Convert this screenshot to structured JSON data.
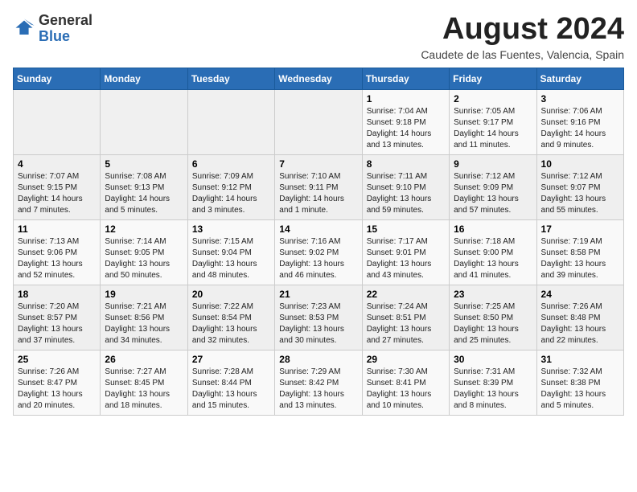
{
  "logo": {
    "general": "General",
    "blue": "Blue"
  },
  "title": "August 2024",
  "location": "Caudete de las Fuentes, Valencia, Spain",
  "weekdays": [
    "Sunday",
    "Monday",
    "Tuesday",
    "Wednesday",
    "Thursday",
    "Friday",
    "Saturday"
  ],
  "weeks": [
    [
      {
        "day": "",
        "info": ""
      },
      {
        "day": "",
        "info": ""
      },
      {
        "day": "",
        "info": ""
      },
      {
        "day": "",
        "info": ""
      },
      {
        "day": "1",
        "info": "Sunrise: 7:04 AM\nSunset: 9:18 PM\nDaylight: 14 hours\nand 13 minutes."
      },
      {
        "day": "2",
        "info": "Sunrise: 7:05 AM\nSunset: 9:17 PM\nDaylight: 14 hours\nand 11 minutes."
      },
      {
        "day": "3",
        "info": "Sunrise: 7:06 AM\nSunset: 9:16 PM\nDaylight: 14 hours\nand 9 minutes."
      }
    ],
    [
      {
        "day": "4",
        "info": "Sunrise: 7:07 AM\nSunset: 9:15 PM\nDaylight: 14 hours\nand 7 minutes."
      },
      {
        "day": "5",
        "info": "Sunrise: 7:08 AM\nSunset: 9:13 PM\nDaylight: 14 hours\nand 5 minutes."
      },
      {
        "day": "6",
        "info": "Sunrise: 7:09 AM\nSunset: 9:12 PM\nDaylight: 14 hours\nand 3 minutes."
      },
      {
        "day": "7",
        "info": "Sunrise: 7:10 AM\nSunset: 9:11 PM\nDaylight: 14 hours\nand 1 minute."
      },
      {
        "day": "8",
        "info": "Sunrise: 7:11 AM\nSunset: 9:10 PM\nDaylight: 13 hours\nand 59 minutes."
      },
      {
        "day": "9",
        "info": "Sunrise: 7:12 AM\nSunset: 9:09 PM\nDaylight: 13 hours\nand 57 minutes."
      },
      {
        "day": "10",
        "info": "Sunrise: 7:12 AM\nSunset: 9:07 PM\nDaylight: 13 hours\nand 55 minutes."
      }
    ],
    [
      {
        "day": "11",
        "info": "Sunrise: 7:13 AM\nSunset: 9:06 PM\nDaylight: 13 hours\nand 52 minutes."
      },
      {
        "day": "12",
        "info": "Sunrise: 7:14 AM\nSunset: 9:05 PM\nDaylight: 13 hours\nand 50 minutes."
      },
      {
        "day": "13",
        "info": "Sunrise: 7:15 AM\nSunset: 9:04 PM\nDaylight: 13 hours\nand 48 minutes."
      },
      {
        "day": "14",
        "info": "Sunrise: 7:16 AM\nSunset: 9:02 PM\nDaylight: 13 hours\nand 46 minutes."
      },
      {
        "day": "15",
        "info": "Sunrise: 7:17 AM\nSunset: 9:01 PM\nDaylight: 13 hours\nand 43 minutes."
      },
      {
        "day": "16",
        "info": "Sunrise: 7:18 AM\nSunset: 9:00 PM\nDaylight: 13 hours\nand 41 minutes."
      },
      {
        "day": "17",
        "info": "Sunrise: 7:19 AM\nSunset: 8:58 PM\nDaylight: 13 hours\nand 39 minutes."
      }
    ],
    [
      {
        "day": "18",
        "info": "Sunrise: 7:20 AM\nSunset: 8:57 PM\nDaylight: 13 hours\nand 37 minutes."
      },
      {
        "day": "19",
        "info": "Sunrise: 7:21 AM\nSunset: 8:56 PM\nDaylight: 13 hours\nand 34 minutes."
      },
      {
        "day": "20",
        "info": "Sunrise: 7:22 AM\nSunset: 8:54 PM\nDaylight: 13 hours\nand 32 minutes."
      },
      {
        "day": "21",
        "info": "Sunrise: 7:23 AM\nSunset: 8:53 PM\nDaylight: 13 hours\nand 30 minutes."
      },
      {
        "day": "22",
        "info": "Sunrise: 7:24 AM\nSunset: 8:51 PM\nDaylight: 13 hours\nand 27 minutes."
      },
      {
        "day": "23",
        "info": "Sunrise: 7:25 AM\nSunset: 8:50 PM\nDaylight: 13 hours\nand 25 minutes."
      },
      {
        "day": "24",
        "info": "Sunrise: 7:26 AM\nSunset: 8:48 PM\nDaylight: 13 hours\nand 22 minutes."
      }
    ],
    [
      {
        "day": "25",
        "info": "Sunrise: 7:26 AM\nSunset: 8:47 PM\nDaylight: 13 hours\nand 20 minutes."
      },
      {
        "day": "26",
        "info": "Sunrise: 7:27 AM\nSunset: 8:45 PM\nDaylight: 13 hours\nand 18 minutes."
      },
      {
        "day": "27",
        "info": "Sunrise: 7:28 AM\nSunset: 8:44 PM\nDaylight: 13 hours\nand 15 minutes."
      },
      {
        "day": "28",
        "info": "Sunrise: 7:29 AM\nSunset: 8:42 PM\nDaylight: 13 hours\nand 13 minutes."
      },
      {
        "day": "29",
        "info": "Sunrise: 7:30 AM\nSunset: 8:41 PM\nDaylight: 13 hours\nand 10 minutes."
      },
      {
        "day": "30",
        "info": "Sunrise: 7:31 AM\nSunset: 8:39 PM\nDaylight: 13 hours\nand 8 minutes."
      },
      {
        "day": "31",
        "info": "Sunrise: 7:32 AM\nSunset: 8:38 PM\nDaylight: 13 hours\nand 5 minutes."
      }
    ]
  ]
}
